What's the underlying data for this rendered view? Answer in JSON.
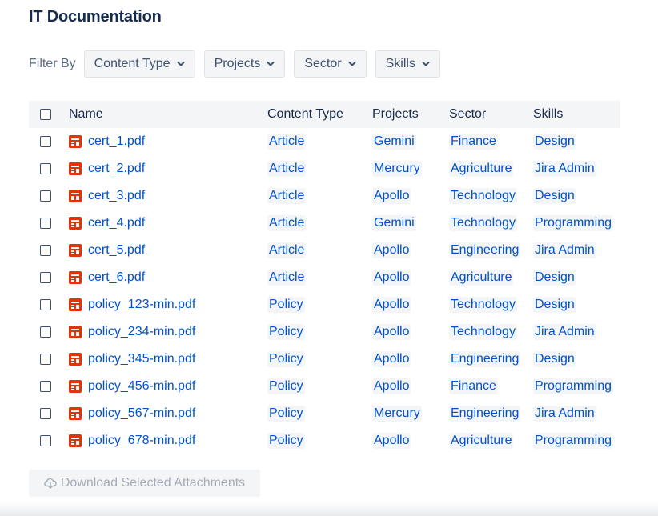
{
  "title": "IT Documentation",
  "filters": {
    "label": "Filter By",
    "buttons": [
      "Content Type",
      "Projects",
      "Sector",
      "Skills"
    ]
  },
  "table": {
    "columns": [
      "Name",
      "Content Type",
      "Projects",
      "Sector",
      "Skills"
    ],
    "rows": [
      {
        "name": "cert_1.pdf",
        "content_type": "Article",
        "project": "Gemini",
        "sector": "Finance",
        "skill": "Design"
      },
      {
        "name": "cert_2.pdf",
        "content_type": "Article",
        "project": "Mercury",
        "sector": "Agriculture",
        "skill": "Jira Admin"
      },
      {
        "name": "cert_3.pdf",
        "content_type": "Article",
        "project": "Apollo",
        "sector": "Technology",
        "skill": "Design"
      },
      {
        "name": "cert_4.pdf",
        "content_type": "Article",
        "project": "Gemini",
        "sector": "Technology",
        "skill": "Programming"
      },
      {
        "name": "cert_5.pdf",
        "content_type": "Article",
        "project": "Apollo",
        "sector": "Engineering",
        "skill": "Jira Admin"
      },
      {
        "name": "cert_6.pdf",
        "content_type": "Article",
        "project": "Apollo",
        "sector": "Agriculture",
        "skill": "Design"
      },
      {
        "name": "policy_123-min.pdf",
        "content_type": "Policy",
        "project": "Apollo",
        "sector": "Technology",
        "skill": "Design"
      },
      {
        "name": "policy_234-min.pdf",
        "content_type": "Policy",
        "project": "Apollo",
        "sector": "Technology",
        "skill": "Jira Admin"
      },
      {
        "name": "policy_345-min.pdf",
        "content_type": "Policy",
        "project": "Apollo",
        "sector": "Engineering",
        "skill": "Design"
      },
      {
        "name": "policy_456-min.pdf",
        "content_type": "Policy",
        "project": "Apollo",
        "sector": "Finance",
        "skill": "Programming"
      },
      {
        "name": "policy_567-min.pdf",
        "content_type": "Policy",
        "project": "Mercury",
        "sector": "Engineering",
        "skill": "Jira Admin"
      },
      {
        "name": "policy_678-min.pdf",
        "content_type": "Policy",
        "project": "Apollo",
        "sector": "Agriculture",
        "skill": "Programming"
      }
    ]
  },
  "download_button": {
    "label": "Download Selected Attachments",
    "icon": "cloud-download-icon",
    "enabled": false
  },
  "colors": {
    "link": "#0052cc",
    "pdf_icon": "#de350b",
    "tag_bg": "#f4f5f7"
  }
}
